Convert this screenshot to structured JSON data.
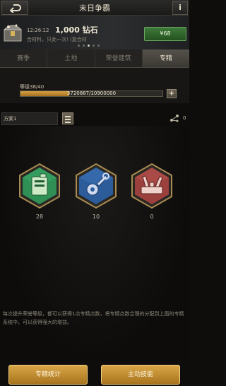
{
  "header": {
    "title": "末日争霸",
    "back_icon": "back-arrow-icon",
    "info_label": "i"
  },
  "promo": {
    "time": "12:26:12",
    "amount": "1,000 钻石",
    "description": "合材料，只此一次! (复合材",
    "price": "¥68",
    "chest_icon": "treasure-chest-icon"
  },
  "tabs": [
    {
      "label": "赛季"
    },
    {
      "label": "土地"
    },
    {
      "label": "荣誉建筑"
    },
    {
      "label": "专精",
      "active": true
    }
  ],
  "level": {
    "label": "等级38/40",
    "progress_text": "3720887/10900000",
    "progress_fraction": 0.341,
    "plus_label": "+"
  },
  "plan": {
    "name": "方案1",
    "share_icon": "share-icon",
    "share_count": "0"
  },
  "skills": [
    {
      "icon": "fuel-canister-icon",
      "count": "28",
      "color": "#3d9a5e"
    },
    {
      "icon": "wrench-gear-icon",
      "count": "10",
      "color": "#3566a6"
    },
    {
      "icon": "twin-cannon-icon",
      "count": "0",
      "color": "#a54a46"
    }
  ],
  "description": "每次提升荣誉等级，都可以获得1点专精点数，将专精点数合理的分配到上面的专精系统中，可以获得强大的增益。",
  "buttons": {
    "stats": "专精统计",
    "active_skill": "主动技能"
  },
  "colors": {
    "accent_gold": "#d9a647",
    "price_green": "#3f7a3c"
  }
}
